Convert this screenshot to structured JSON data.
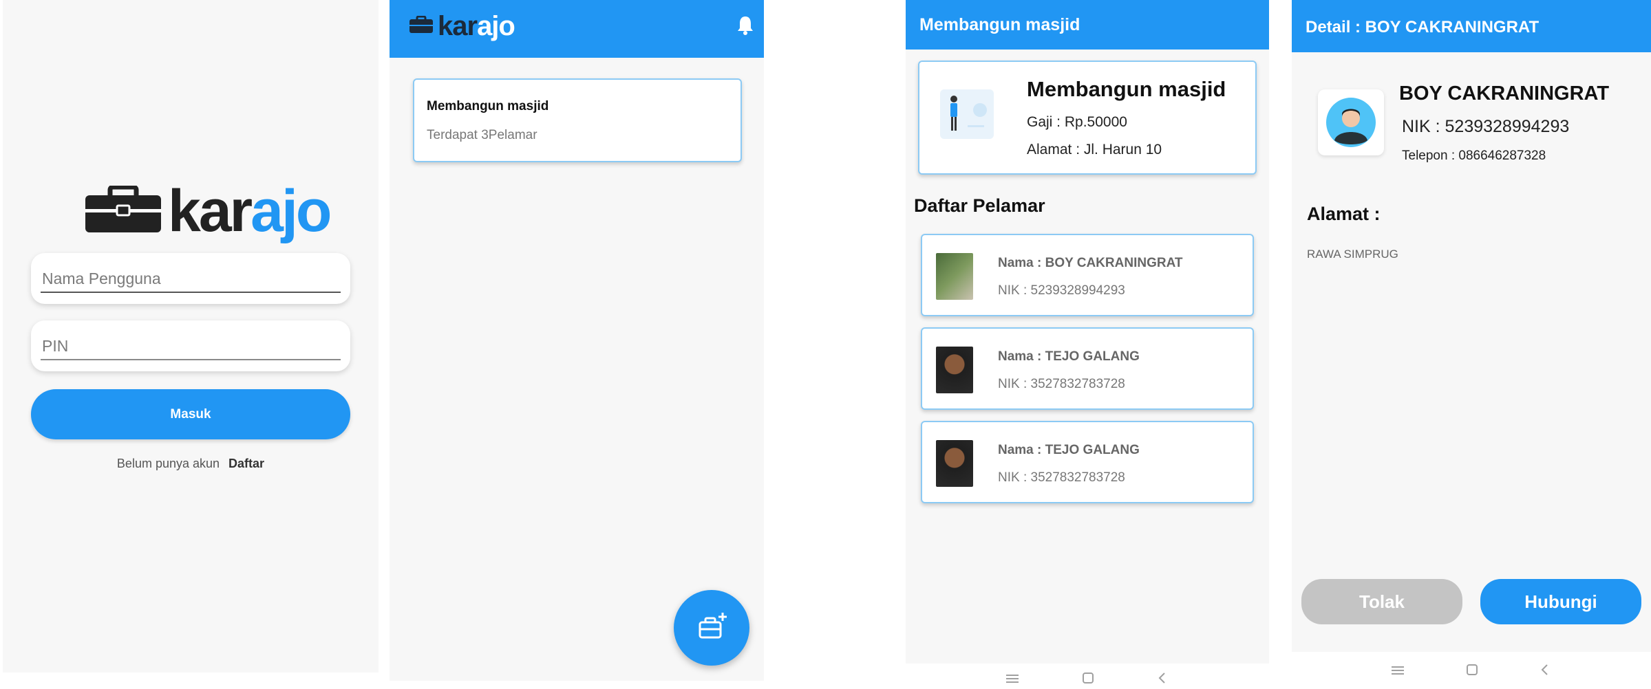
{
  "colors": {
    "primary": "#2196f3",
    "reject": "#c4c4c4",
    "background": "#f7f7f7"
  },
  "login": {
    "logo": {
      "part1": "kar",
      "part2": "ajo",
      "icon": "briefcase-icon"
    },
    "username_placeholder": "Nama Pengguna",
    "pin_placeholder": "PIN",
    "login_button": "Masuk",
    "register_prompt": "Belum punya akun",
    "register_link": "Daftar"
  },
  "home": {
    "logo": {
      "part1": "kar",
      "part2": "ajo",
      "icon": "briefcase-icon"
    },
    "notification_icon": "bell-icon",
    "job": {
      "title": "Membangun masjid",
      "subtitle": "Terdapat 3Pelamar"
    },
    "fab_icon": "add-job-icon"
  },
  "job_detail": {
    "title": "Membangun masjid",
    "card": {
      "title": "Membangun masjid",
      "salary": "Gaji : Rp.50000",
      "address": "Alamat : Jl. Harun 10"
    },
    "applicants_heading": "Daftar Pelamar",
    "applicants": [
      {
        "name": "Nama : BOY CAKRANINGRAT",
        "nik": "NIK : 5239328994293"
      },
      {
        "name": "Nama : TEJO GALANG",
        "nik": "NIK : 3527832783728"
      },
      {
        "name": "Nama : TEJO GALANG",
        "nik": "NIK : 3527832783728"
      }
    ]
  },
  "applicant_detail": {
    "title": "Detail : BOY CAKRANINGRAT",
    "name": "BOY CAKRANINGRAT",
    "nik": "NIK  : 5239328994293",
    "phone": "Telepon : 086646287328",
    "address_label": "Alamat :",
    "address": "RAWA SIMPRUG",
    "reject_button": "Tolak",
    "contact_button": "Hubungi"
  }
}
